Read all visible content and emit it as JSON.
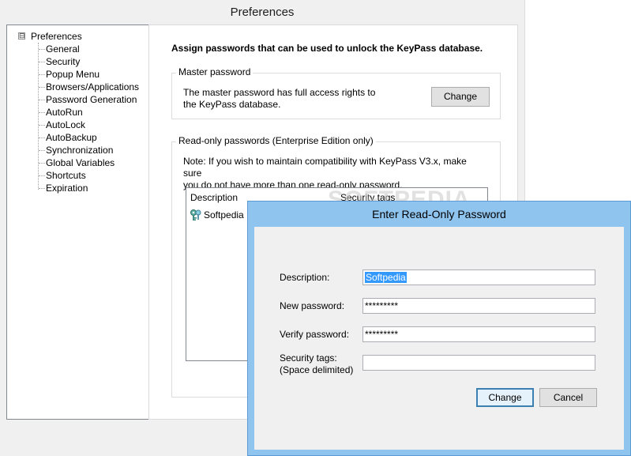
{
  "window": {
    "title": "Preferences"
  },
  "tree": {
    "expander": "⊟",
    "root": "Preferences",
    "items": [
      "General",
      "Security",
      "Popup Menu",
      "Browsers/Applications",
      "Password Generation",
      "AutoRun",
      "AutoLock",
      "AutoBackup",
      "Synchronization",
      "Global Variables",
      "Shortcuts",
      "Expiration"
    ],
    "selected": "Security"
  },
  "content": {
    "intro": "Assign passwords that can be used to unlock the KeyPass database.",
    "master": {
      "legend": "Master password",
      "description_line1": "The master password has full access rights to",
      "description_line2": "the KeyPass database.",
      "button": "Change"
    },
    "readonly": {
      "legend": "Read-only passwords (Enterprise Edition only)",
      "note_line1": "Note: If you wish to maintain compatibility with KeyPass V3.x, make sure",
      "note_line2": "you do not have more than one read-only password.",
      "columns": [
        "Description",
        "Security tags"
      ],
      "rows": [
        {
          "description": "Softpedia",
          "icon": "key-icon"
        }
      ]
    }
  },
  "dialog": {
    "title": "Enter Read-Only Password",
    "description_label": "Description:",
    "description_value": "Softpedia",
    "new_password_label": "New password:",
    "new_password_value": "*********",
    "verify_password_label": "Verify password:",
    "verify_password_value": "*********",
    "security_tags_label": "Security tags:",
    "security_tags_sublabel": "(Space delimited)",
    "security_tags_value": "",
    "change_button": "Change",
    "cancel_button": "Cancel"
  },
  "watermark": "SOFTPEDIA",
  "colors": {
    "dialog_frame": "#8fc4ef",
    "selection": "#3399ff",
    "default_button_border": "#3c7fb1"
  }
}
